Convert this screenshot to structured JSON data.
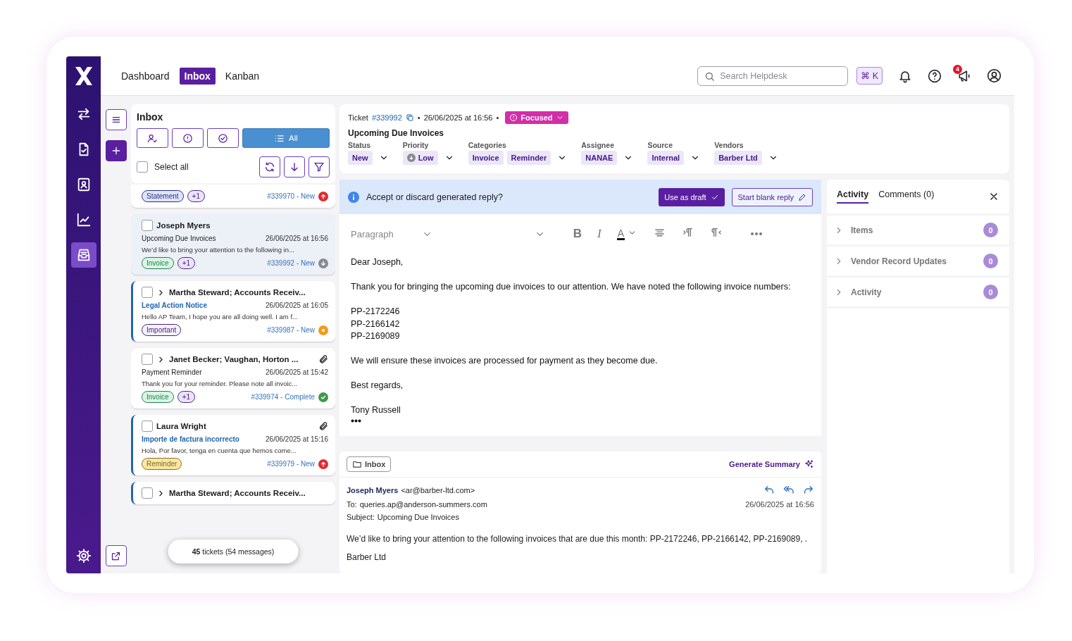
{
  "header": {
    "nav": [
      {
        "label": "Dashboard",
        "selected": false
      },
      {
        "label": "Inbox",
        "selected": true
      },
      {
        "label": "Kanban",
        "selected": false
      }
    ],
    "search": {
      "placeholder": "Search Helpdesk"
    },
    "shortcut": "⌘ K",
    "notification_badge": "4"
  },
  "rail": {
    "items": [
      {
        "kind": "transfer",
        "selected": false
      },
      {
        "kind": "document",
        "selected": false
      },
      {
        "kind": "contact",
        "selected": false
      },
      {
        "kind": "chart",
        "selected": false
      },
      {
        "kind": "inbox",
        "selected": true
      }
    ]
  },
  "inbox": {
    "title": "Inbox",
    "filters": [
      {
        "kind": "assigned",
        "selected": false
      },
      {
        "kind": "priority",
        "selected": false
      },
      {
        "kind": "done",
        "selected": false
      },
      {
        "kind": "all",
        "label": "All",
        "selected": true
      }
    ],
    "select_all": {
      "label": "Select all",
      "checked": false
    },
    "tickets": [
      {
        "selected": false,
        "unread": false,
        "tags": [
          {
            "label": "Statement",
            "color": "#e0e4fb"
          },
          {
            "label": "+1",
            "color": "#ece3fb"
          }
        ],
        "ticket": "#339970 - New",
        "status": {
          "kind": "high"
        }
      },
      {
        "selected": true,
        "unread": false,
        "checked": false,
        "expandable": false,
        "attachment": false,
        "name": "Joseph Myers",
        "subject": "Upcoming Due Invoices",
        "subject_highlight": false,
        "date": "26/06/2025 at 16:56",
        "preview": "We’d like to bring your attention to the following in...",
        "tags": [
          {
            "label": "Invoice",
            "color": "#d8f5e5"
          },
          {
            "label": "+1",
            "color": "#ece3fb"
          }
        ],
        "ticket": "#339992 - New",
        "status": {
          "kind": "low"
        }
      },
      {
        "selected": false,
        "unread": true,
        "checked": false,
        "expandable": true,
        "attachment": false,
        "name": "Martha Steward; Accounts Receiv...",
        "subject": "Legal Action Notice",
        "subject_highlight": true,
        "date": "26/06/2025 at 16:05",
        "preview": "Hello AP Team, I hope you are all doing well. I am f...",
        "tags": [
          {
            "label": "Important",
            "color": "#f6f1ff"
          }
        ],
        "ticket": "#339987 - New",
        "status": {
          "kind": "medium"
        }
      },
      {
        "selected": false,
        "unread": false,
        "checked": false,
        "expandable": true,
        "attachment": true,
        "name": "Janet Becker; Vaughan, Horton ...",
        "subject": "Payment Reminder",
        "subject_highlight": false,
        "date": "26/06/2025 at 15:42",
        "preview": "Thank you for your reminder. Please note all invoic...",
        "tags": [
          {
            "label": "Invoice",
            "color": "#d8f5e5"
          },
          {
            "label": "+1",
            "color": "#ece3fb"
          }
        ],
        "ticket": "#339974 - Complete",
        "status": {
          "kind": "complete"
        }
      },
      {
        "selected": false,
        "unread": true,
        "checked": false,
        "expandable": false,
        "attachment": true,
        "name": "Laura Wright",
        "subject": "Importe de factura incorrecto",
        "subject_highlight": true,
        "date": "26/06/2025 at 15:16",
        "preview": "Hola, Por favor, tenga en cuenta que hemos come...",
        "tags": [
          {
            "label": "Reminder",
            "color": "#fbe7a3"
          }
        ],
        "ticket": "#339979 - New",
        "status": {
          "kind": "high"
        }
      },
      {
        "selected": false,
        "unread": true,
        "checked": false,
        "expandable": true,
        "attachment": false,
        "name": "Martha Steward; Accounts Receiv..."
      }
    ],
    "summary": "**45** tickets (54 messages)"
  },
  "ticket": {
    "label": "Ticket",
    "number": "#339992",
    "separator": "•",
    "date": "26/06/2025 at 16:56",
    "separator_2": "•",
    "focus": "Focused",
    "title": "Upcoming Due Invoices",
    "fields": [
      {
        "label": "Status",
        "kind": "plain",
        "values": [
          "New"
        ]
      },
      {
        "label": "Priority",
        "kind": "priority",
        "values": [
          "Low"
        ]
      },
      {
        "label": "Categories",
        "kind": "plain",
        "values": [
          "Invoice",
          "Reminder"
        ]
      },
      {
        "label": "Assignee",
        "kind": "plain",
        "values": [
          "NANAE"
        ]
      },
      {
        "label": "Source",
        "kind": "plain",
        "values": [
          "Internal"
        ]
      },
      {
        "label": "Vendors",
        "kind": "plain",
        "values": [
          "Barber Ltd"
        ]
      }
    ]
  },
  "banner": {
    "text": "Accept or discard generated reply?",
    "primary": "Use as draft",
    "secondary": "Start blank reply"
  },
  "editor": {
    "block_style": "Paragraph",
    "format_buttons": [
      {
        "kind": "bold",
        "glyph": "B"
      },
      {
        "kind": "italic",
        "glyph": "I"
      },
      {
        "kind": "color",
        "glyph": "A"
      }
    ],
    "paragraphs": [
      [
        "Dear Joseph,"
      ],
      [
        "Thank you for bringing the upcoming due invoices to our attention. We have noted the following invoice numbers:"
      ],
      [
        "PP-2172246",
        "PP-2166142",
        "PP-2169089"
      ],
      [
        "We will ensure these invoices are processed for payment as they become due."
      ],
      [
        "Best regards,"
      ],
      [
        "Tony Russell"
      ]
    ]
  },
  "message": {
    "folder": "Inbox",
    "summary_action": "Generate Summary",
    "from_name": "Joseph Myers",
    "from_email": "<ar@barber-ltd.com>",
    "to_label": "To:",
    "to": "queries.ap@anderson-summers.com",
    "date": "26/06/2025 at 16:56",
    "subject_label": "Subject:",
    "subject": "Upcoming Due Invoices",
    "body": [
      "We’d like to bring your attention to the following invoices that are due this month: PP-2172246, PP-2166142, PP-2169089, .",
      "Barber Ltd"
    ]
  },
  "side_panel": {
    "tabs": [
      {
        "label": "Activity",
        "selected": true
      },
      {
        "label": "Comments (0)",
        "selected": false
      }
    ],
    "sections": [
      {
        "label": "Items",
        "count": "0"
      },
      {
        "label": "Vendor Record Updates",
        "count": "0"
      },
      {
        "label": "Activity",
        "count": "0"
      }
    ]
  }
}
